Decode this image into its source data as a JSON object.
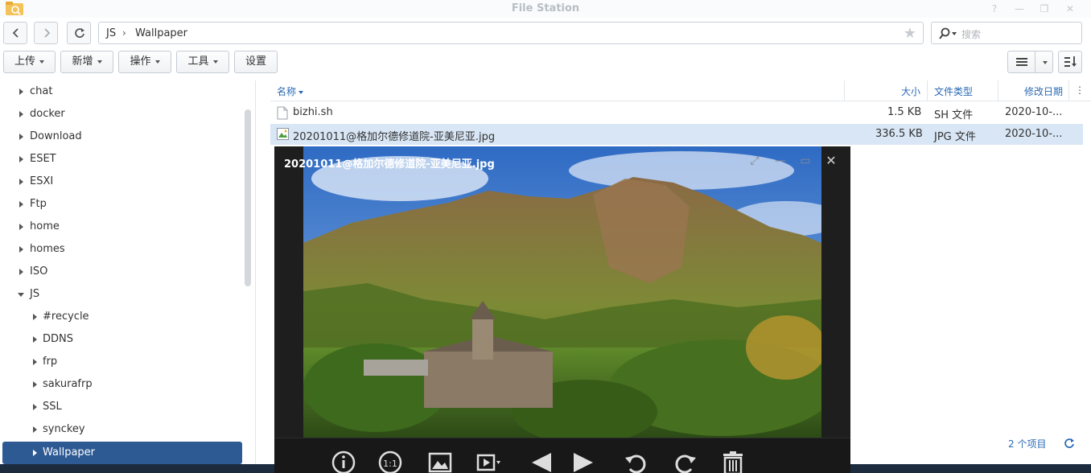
{
  "window": {
    "title": "File Station"
  },
  "path": {
    "crumbs": [
      "JS",
      "Wallpaper"
    ],
    "separator": "›"
  },
  "search": {
    "placeholder": "搜索"
  },
  "toolbar": {
    "upload": "上传",
    "create": "新增",
    "action": "操作",
    "tools": "工具",
    "settings": "设置"
  },
  "sidebar": {
    "items": [
      {
        "label": "chat",
        "level": 0,
        "expanded": false
      },
      {
        "label": "docker",
        "level": 0,
        "expanded": false
      },
      {
        "label": "Download",
        "level": 0,
        "expanded": false
      },
      {
        "label": "ESET",
        "level": 0,
        "expanded": false
      },
      {
        "label": "ESXI",
        "level": 0,
        "expanded": false
      },
      {
        "label": "Ftp",
        "level": 0,
        "expanded": false
      },
      {
        "label": "home",
        "level": 0,
        "expanded": false
      },
      {
        "label": "homes",
        "level": 0,
        "expanded": false
      },
      {
        "label": "ISO",
        "level": 0,
        "expanded": false
      },
      {
        "label": "JS",
        "level": 0,
        "expanded": true
      },
      {
        "label": "#recycle",
        "level": 1,
        "expanded": false
      },
      {
        "label": "DDNS",
        "level": 1,
        "expanded": false
      },
      {
        "label": "frp",
        "level": 1,
        "expanded": false
      },
      {
        "label": "sakurafrp",
        "level": 1,
        "expanded": false
      },
      {
        "label": "SSL",
        "level": 1,
        "expanded": false
      },
      {
        "label": "synckey",
        "level": 1,
        "expanded": false
      },
      {
        "label": "Wallpaper",
        "level": 1,
        "expanded": false,
        "selected": true
      }
    ]
  },
  "list": {
    "columns": {
      "name": "名称",
      "size": "大小",
      "type": "文件类型",
      "modified": "修改日期"
    },
    "rows": [
      {
        "name": "bizhi.sh",
        "size": "1.5 KB",
        "type": "SH 文件",
        "modified": "2020-10-..."
      },
      {
        "name": "20201011@格加尔德修道院-亚美尼亚.jpg",
        "size": "336.5 KB",
        "type": "JPG 文件",
        "modified": "2020-10-..."
      }
    ],
    "status": "2 个项目"
  },
  "viewer": {
    "title": "20201011@格加尔德修道院-亚美尼亚.jpg"
  },
  "colors": {
    "accent": "#2e5a94",
    "link": "#2a6ab5",
    "selected_row": "#d8e6f5"
  }
}
